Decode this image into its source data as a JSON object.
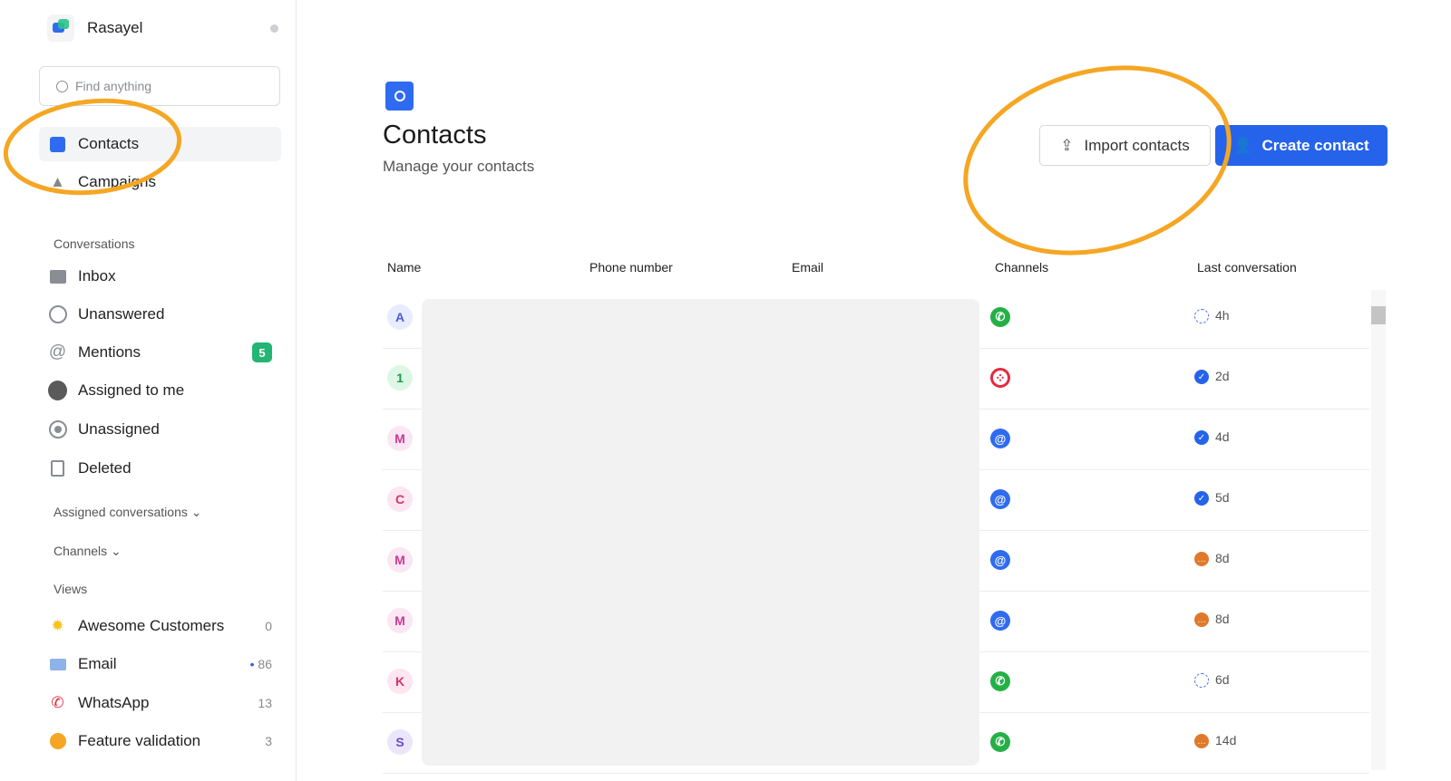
{
  "app": {
    "name": "Rasayel"
  },
  "search": {
    "placeholder": "Find anything"
  },
  "nav": {
    "contacts": "Contacts",
    "campaigns": "Campaigns"
  },
  "conversations": {
    "heading": "Conversations",
    "items": [
      {
        "label": "Inbox"
      },
      {
        "label": "Unanswered"
      },
      {
        "label": "Mentions",
        "badge": "5"
      },
      {
        "label": "Assigned to me"
      },
      {
        "label": "Unassigned"
      },
      {
        "label": "Deleted"
      }
    ]
  },
  "assigned_conversations": "Assigned conversations",
  "channels": "Channels",
  "views": {
    "heading": "Views",
    "items": [
      {
        "label": "Awesome Customers",
        "count": "0"
      },
      {
        "label": "Email",
        "count": "86"
      },
      {
        "label": "WhatsApp",
        "count": "13"
      },
      {
        "label": "Feature validation",
        "count": "3"
      }
    ]
  },
  "page": {
    "title": "Contacts",
    "subtitle": "Manage your contacts",
    "import_label": "Import contacts",
    "create_label": "Create contact"
  },
  "table": {
    "headers": [
      "Name",
      "Phone number",
      "Email",
      "Channels",
      "Last conversation"
    ],
    "rows": [
      {
        "initial": "A",
        "channel": "whatsapp",
        "status": "open",
        "time": "4h"
      },
      {
        "initial": "1",
        "channel": "twilio",
        "status": "resolved",
        "time": "2d"
      },
      {
        "initial": "M",
        "channel": "email",
        "status": "resolved",
        "time": "4d"
      },
      {
        "initial": "C",
        "channel": "email",
        "status": "resolved",
        "time": "5d"
      },
      {
        "initial": "M",
        "channel": "email",
        "status": "pending",
        "time": "8d"
      },
      {
        "initial": "M",
        "channel": "email",
        "status": "pending",
        "time": "8d"
      },
      {
        "initial": "K",
        "channel": "whatsapp",
        "status": "open",
        "time": "6d"
      },
      {
        "initial": "S",
        "channel": "whatsapp",
        "status": "pending",
        "time": "14d"
      }
    ]
  },
  "colors": {
    "accent": "#2563eb",
    "annotation": "#f5a623",
    "whatsapp": "#25b047",
    "twilio": "#e8283f",
    "badge": "#22b573",
    "pending": "#e0792b"
  }
}
